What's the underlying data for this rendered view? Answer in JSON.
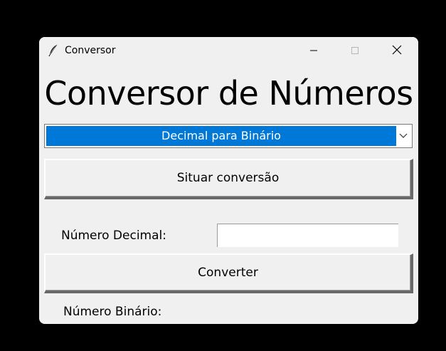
{
  "window": {
    "title": "Conversor",
    "icon": "feather-icon",
    "controls": [
      "minimize-icon",
      "maximize-icon",
      "close-icon"
    ]
  },
  "main": {
    "heading": "Conversor de Números",
    "conversion_select": {
      "selected": "Decimal para Binário",
      "selection_color": "#0078d7"
    },
    "situar_button_label": "Situar conversão",
    "input_label": "Número Decimal:",
    "input_value": "",
    "convert_button_label": "Converter",
    "result_label": "Número Binário:",
    "result_value": ""
  }
}
